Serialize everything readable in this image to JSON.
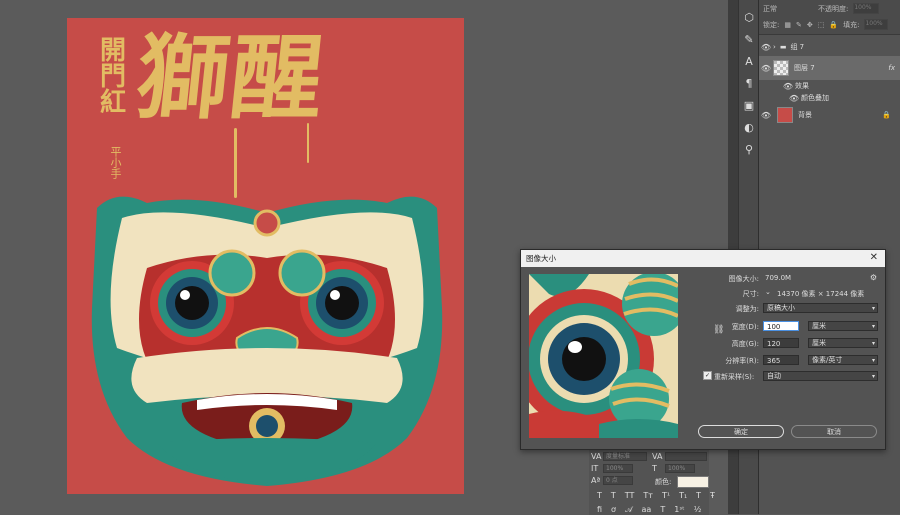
{
  "artwork": {
    "big_title": "獅醒",
    "side_text": "開門紅",
    "signature": "平小手"
  },
  "layers_panel": {
    "blend_mode": "正常",
    "opacity_label": "不透明度:",
    "opacity_value": "100%",
    "lock_label": "锁定:",
    "fill_label": "填充:",
    "fill_value": "100%",
    "layers": [
      {
        "name": "组 7",
        "type": "group"
      },
      {
        "name": "图层 7",
        "type": "layer",
        "fx": "fx"
      },
      {
        "name": "效果",
        "type": "effect"
      },
      {
        "name": "颜色叠加",
        "type": "effect-item"
      },
      {
        "name": "背景",
        "type": "background"
      }
    ]
  },
  "dialog": {
    "title": "图像大小",
    "image_size_label": "图像大小:",
    "image_size_value": "709.0M",
    "dimensions_label": "尺寸:",
    "dimensions_value": "14370 像素 × 17244 像素",
    "fit_label": "调整为:",
    "fit_value": "原稿大小",
    "width_label": "宽度(D):",
    "width_value": "100",
    "width_unit": "厘米",
    "height_label": "高度(G):",
    "height_value": "120",
    "height_unit": "厘米",
    "resolution_label": "分辨率(R):",
    "resolution_value": "365",
    "resolution_unit": "像素/英寸",
    "resample_label": "重新采样(S):",
    "resample_value": "自动",
    "ok_label": "确定",
    "cancel_label": "取消"
  },
  "character_panel": {
    "kerning_placeholder": "度量标准",
    "scale_v": "100%",
    "scale_h": "100%",
    "baseline": "0 点",
    "color_label": "颜色:"
  },
  "colors": {
    "poster_red": "#c64c48",
    "gold": "#e2bc63",
    "teal": "#2a8f7e",
    "panel": "#535353"
  }
}
